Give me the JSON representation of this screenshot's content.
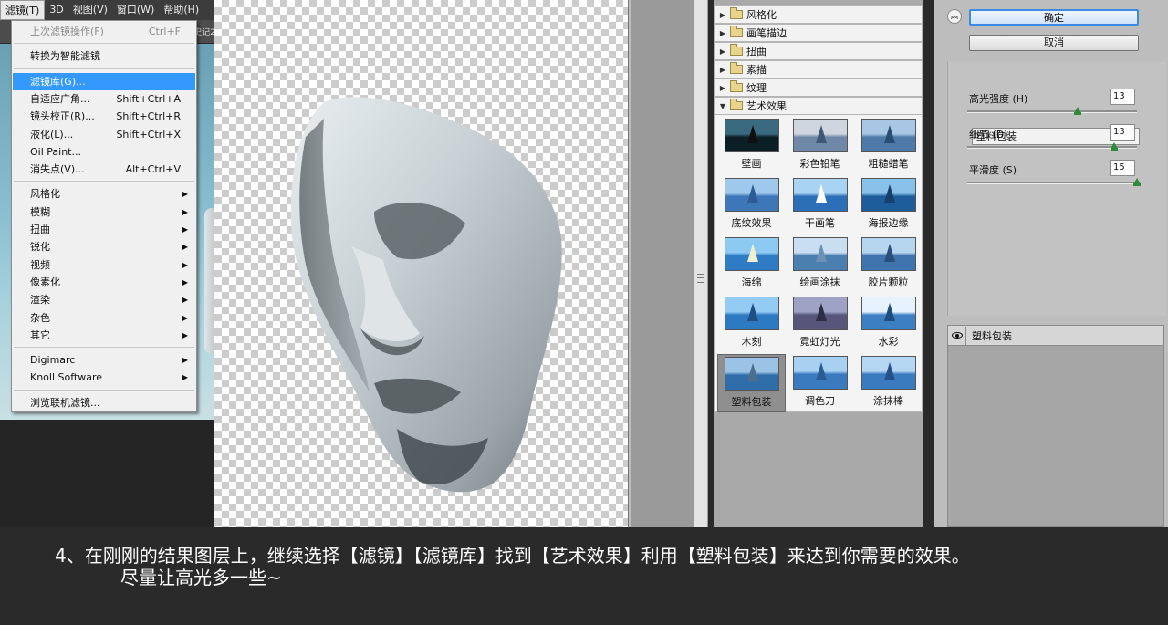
{
  "menubar": {
    "items": [
      "滤镜(T)",
      "3D",
      "视图(V)",
      "窗口(W)",
      "帮助(H)"
    ],
    "active_index": 0,
    "right_hint": "史记2"
  },
  "filter_menu": {
    "groups": [
      [
        {
          "label": "上次滤镜操作(F)",
          "shortcut": "Ctrl+F",
          "disabled": true
        }
      ],
      [
        {
          "label": "转换为智能滤镜"
        }
      ],
      [
        {
          "label": "滤镜库(G)...",
          "selected": true
        },
        {
          "label": "自适应广角...",
          "shortcut": "Shift+Ctrl+A"
        },
        {
          "label": "镜头校正(R)...",
          "shortcut": "Shift+Ctrl+R"
        },
        {
          "label": "液化(L)...",
          "shortcut": "Shift+Ctrl+X"
        },
        {
          "label": "Oil Paint..."
        },
        {
          "label": "消失点(V)...",
          "shortcut": "Alt+Ctrl+V"
        }
      ],
      [
        {
          "label": "风格化",
          "submenu": true
        },
        {
          "label": "模糊",
          "submenu": true
        },
        {
          "label": "扭曲",
          "submenu": true
        },
        {
          "label": "锐化",
          "submenu": true
        },
        {
          "label": "视频",
          "submenu": true
        },
        {
          "label": "像素化",
          "submenu": true
        },
        {
          "label": "渲染",
          "submenu": true
        },
        {
          "label": "杂色",
          "submenu": true
        },
        {
          "label": "其它",
          "submenu": true
        }
      ],
      [
        {
          "label": "Digimarc",
          "submenu": true
        },
        {
          "label": "Knoll Software",
          "submenu": true
        }
      ],
      [
        {
          "label": "浏览联机滤镜..."
        }
      ]
    ]
  },
  "gallery": {
    "categories": [
      {
        "label": "风格化",
        "expanded": false
      },
      {
        "label": "画笔描边",
        "expanded": false
      },
      {
        "label": "扭曲",
        "expanded": false
      },
      {
        "label": "素描",
        "expanded": false
      },
      {
        "label": "纹理",
        "expanded": false
      },
      {
        "label": "艺术效果",
        "expanded": true
      }
    ],
    "thumbnails": [
      {
        "label": "壁画"
      },
      {
        "label": "彩色铅笔"
      },
      {
        "label": "粗糙蜡笔"
      },
      {
        "label": "底纹效果"
      },
      {
        "label": "干画笔"
      },
      {
        "label": "海报边缘"
      },
      {
        "label": "海绵"
      },
      {
        "label": "绘画涂抹"
      },
      {
        "label": "胶片颗粒"
      },
      {
        "label": "木刻"
      },
      {
        "label": "霓虹灯光"
      },
      {
        "label": "水彩"
      },
      {
        "label": "塑料包装",
        "selected": true
      },
      {
        "label": "调色刀"
      },
      {
        "label": "涂抹棒"
      }
    ]
  },
  "settings": {
    "ok_label": "确定",
    "cancel_label": "取消",
    "filter_select": "塑料包装",
    "params": [
      {
        "label": "高光强度 (H)",
        "value": "13",
        "max": 20
      },
      {
        "label": "细节 (D)",
        "value": "13",
        "max": 15
      },
      {
        "label": "平滑度 (S)",
        "value": "15",
        "max": 15
      }
    ],
    "effect_layer": "塑料包装"
  },
  "caption": {
    "line1": "4、在刚刚的结果图层上，继续选择【滤镜】【滤镜库】找到【艺术效果】利用【塑料包装】来达到你需要的效果。",
    "line2": "尽量让高光多一些~"
  }
}
